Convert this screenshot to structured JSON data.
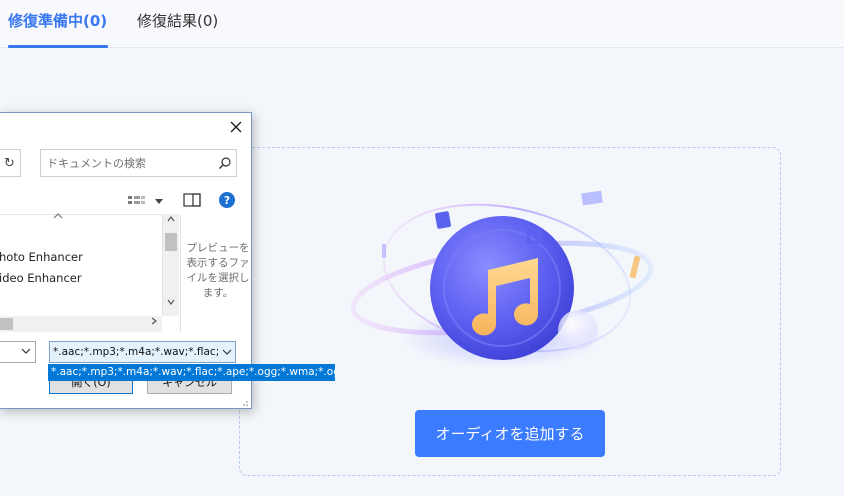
{
  "tabs": [
    {
      "label": "修復準備中(0)",
      "active": true
    },
    {
      "label": "修復結果(0)",
      "active": false
    }
  ],
  "dropzone": {
    "add_button_label": "オーディオを追加する",
    "illustration_icon": "music-note-icon"
  },
  "dialog": {
    "search_placeholder": "ドキュメントの検索",
    "files": [
      "hoto Enhancer",
      "ideo Enhancer"
    ],
    "preview_text": "プレビューを表示するファイルを選択します。",
    "filetype_value": "*.aac;*.mp3;*.m4a;*.wav;*.flac;*.",
    "filetype_option": "*.aac;*.mp3;*.m4a;*.wav;*.flac;*.ape;*.ogg;*.wma;*.oga",
    "open_button_label": "開く(O)",
    "cancel_button_label": "キャンセル",
    "help_label": "?",
    "refresh_glyph": "↻"
  },
  "colors": {
    "accent": "#3a78f2",
    "button": "#3b7bff",
    "selection": "#0078d7"
  }
}
